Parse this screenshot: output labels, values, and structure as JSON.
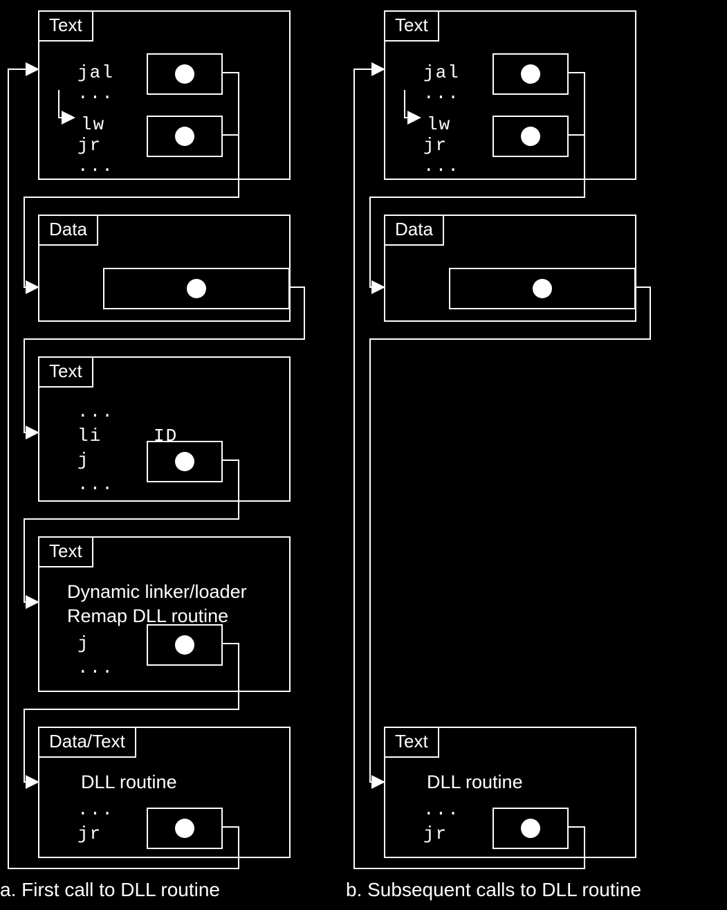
{
  "left": {
    "caption": "a. First call to DLL routine",
    "box1": {
      "tab": "Text",
      "instr1": "jal",
      "instr2": "...",
      "instr3": "lw",
      "instr4": "jr",
      "instr5": "..."
    },
    "box2": {
      "tab": "Data"
    },
    "box3": {
      "tab": "Text",
      "instr0": "...",
      "instr1": "li",
      "id": "ID",
      "instr2": "j",
      "instr3": "..."
    },
    "box4": {
      "tab": "Text",
      "line1": "Dynamic linker/loader",
      "line2": "Remap DLL routine",
      "instr1": "j",
      "instr2": "..."
    },
    "box5": {
      "tab": "Data/Text",
      "line1": "DLL routine",
      "instr1": "...",
      "instr2": "jr"
    }
  },
  "right": {
    "caption": "b. Subsequent calls to DLL routine",
    "box1": {
      "tab": "Text",
      "instr1": "jal",
      "instr2": "...",
      "instr3": "lw",
      "instr4": "jr",
      "instr5": "..."
    },
    "box2": {
      "tab": "Data"
    },
    "box3": {
      "tab": "Text",
      "line1": "DLL routine",
      "instr1": "...",
      "instr2": "jr"
    }
  }
}
